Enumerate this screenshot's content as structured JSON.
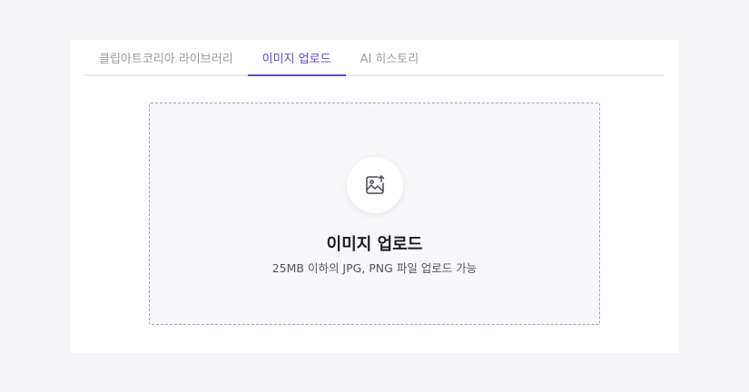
{
  "tabs": [
    {
      "label": "클립아트코리아 라이브러리",
      "active": false
    },
    {
      "label": "이미지 업로드",
      "active": true
    },
    {
      "label": "AI 히스토리",
      "active": false
    }
  ],
  "upload": {
    "icon": "image-upload-icon",
    "title": "이미지 업로드",
    "description": "25MB 이하의 JPG, PNG 파일 업로드 가능"
  },
  "colors": {
    "accent": "#5b4ad6",
    "background": "#f5f5f7",
    "dropzone_border": "#a7a2c9"
  }
}
